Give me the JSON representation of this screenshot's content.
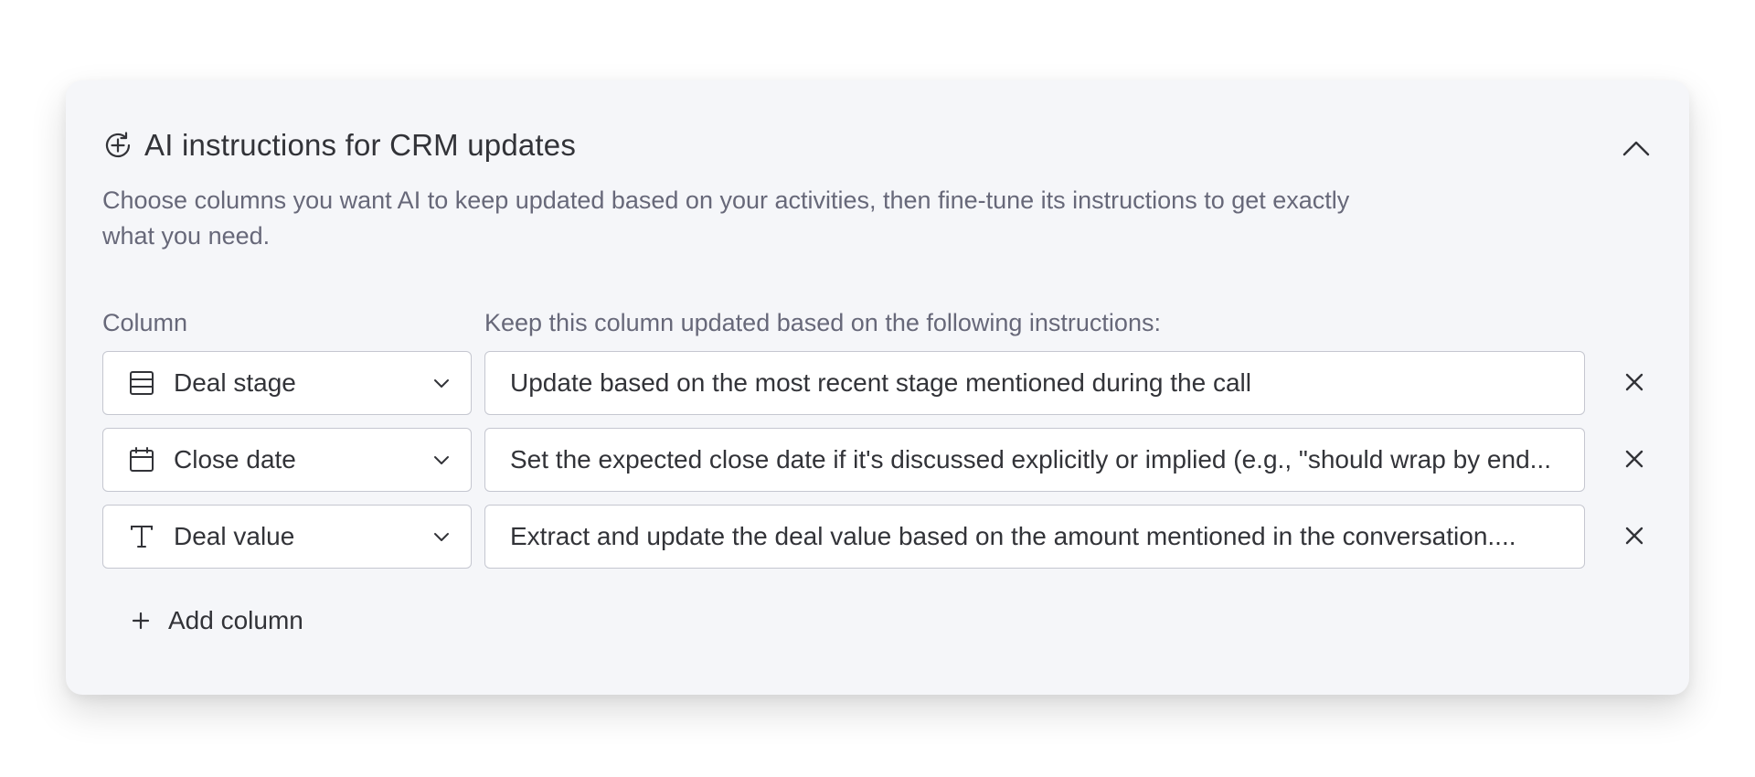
{
  "panel": {
    "title": "AI instructions for CRM updates",
    "description": "Choose columns you want AI to keep updated based on your activities, then fine-tune its instructions to get exactly what you need.",
    "title_icon": "ai-sparkle-refresh-icon",
    "collapse_icon": "chevron-up-icon"
  },
  "table": {
    "column_header": "Column",
    "instructions_header": "Keep this column updated based on the following instructions:",
    "rows": [
      {
        "column": "Deal stage",
        "column_icon": "status-list-icon",
        "instruction": "Update based on the most recent stage mentioned during the call"
      },
      {
        "column": "Close date",
        "column_icon": "calendar-icon",
        "instruction": "Set the expected close date if it's discussed explicitly or implied (e.g., \"should wrap by end..."
      },
      {
        "column": "Deal value",
        "column_icon": "text-type-icon",
        "instruction": "Extract and update the deal value based on the amount mentioned in the conversation...."
      }
    ]
  },
  "add_column": {
    "label": "Add column",
    "icon": "plus-icon"
  },
  "colors": {
    "panel_background": "#f5f6f9",
    "border": "#c5c7d0",
    "text_primary": "#323338",
    "text_secondary": "#676879"
  }
}
